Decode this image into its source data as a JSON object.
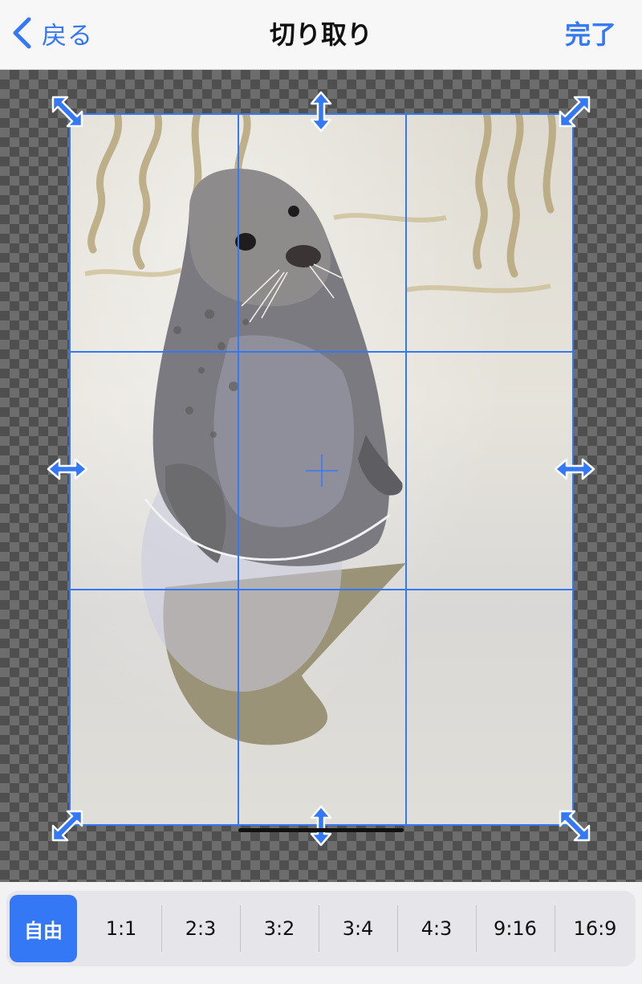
{
  "colors": {
    "accent": "#3478f6",
    "canvas_checker": "#6d6d6d"
  },
  "navbar": {
    "back_icon": "chevron-left-icon",
    "back_label": "戻る",
    "title": "切り取り",
    "done_label": "完了"
  },
  "crop": {
    "grid": "3x3",
    "handles": [
      "resize-nw-icon",
      "resize-n-icon",
      "resize-ne-icon",
      "resize-w-icon",
      "resize-e-icon",
      "resize-sw-icon",
      "resize-s-icon",
      "resize-se-icon"
    ]
  },
  "aspect_ratios": {
    "selected": "自由",
    "options": [
      "自由",
      "1:1",
      "2:3",
      "3:2",
      "3:4",
      "4:3",
      "9:16",
      "16:9"
    ]
  }
}
